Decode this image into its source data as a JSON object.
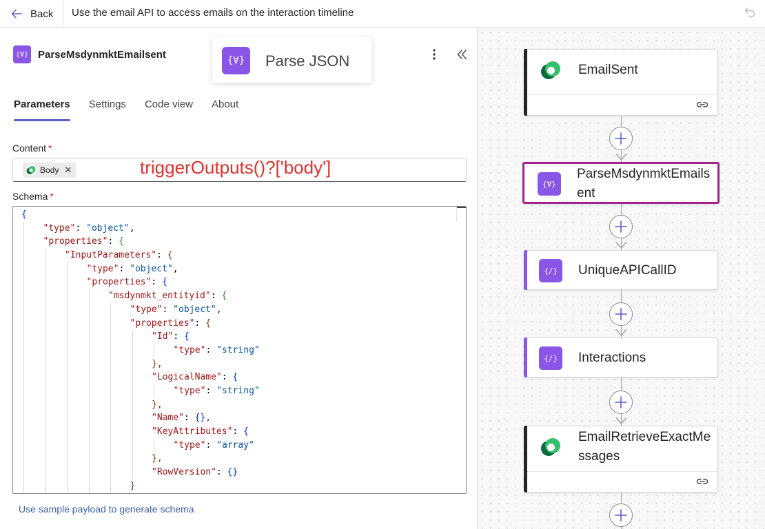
{
  "topbar": {
    "back_label": "Back",
    "title": "Use the email API to access emails on the interaction timeline"
  },
  "panel": {
    "action_name": "ParseMsdynmktEmailsent",
    "action_icon_glyph": "{∀}",
    "hover_label": "Parse JSON",
    "tabs": [
      {
        "label": "Parameters",
        "active": true
      },
      {
        "label": "Settings",
        "active": false
      },
      {
        "label": "Code view",
        "active": false
      },
      {
        "label": "About",
        "active": false
      }
    ],
    "content_label": "Content",
    "required_mark": "*",
    "content_token": "Body",
    "token_remove": "✕",
    "annotation": "triggerOutputs()?['body']",
    "schema_label": "Schema",
    "sample_link": "Use sample payload to generate schema"
  },
  "schema_lines": [
    [
      "b1",
      0,
      "{"
    ],
    [
      "kv",
      1,
      "\"type\"",
      "\"object\"",
      ","
    ],
    [
      "ko",
      1,
      "\"properties\"",
      "{"
    ],
    [
      "ko",
      2,
      "\"InputParameters\"",
      "{"
    ],
    [
      "kv",
      3,
      "\"type\"",
      "\"object\"",
      ","
    ],
    [
      "ko",
      3,
      "\"properties\"",
      "{"
    ],
    [
      "ko",
      4,
      "\"msdynmkt_entityid\"",
      "{"
    ],
    [
      "kv",
      5,
      "\"type\"",
      "\"object\"",
      ","
    ],
    [
      "ko",
      5,
      "\"properties\"",
      "{"
    ],
    [
      "ko",
      6,
      "\"Id\"",
      "{"
    ],
    [
      "kv",
      7,
      "\"type\"",
      "\"string\"",
      ""
    ],
    [
      "cl",
      6,
      "},"
    ],
    [
      "ko",
      6,
      "\"LogicalName\"",
      "{"
    ],
    [
      "kv",
      7,
      "\"type\"",
      "\"string\"",
      ""
    ],
    [
      "cl",
      6,
      "},"
    ],
    [
      "ke",
      6,
      "\"Name\"",
      "{},"
    ],
    [
      "ko",
      6,
      "\"KeyAttributes\"",
      "{"
    ],
    [
      "kv",
      7,
      "\"type\"",
      "\"array\"",
      ""
    ],
    [
      "cl",
      6,
      "},"
    ],
    [
      "ke",
      6,
      "\"RowVersion\"",
      "{}"
    ],
    [
      "cl",
      5,
      "}"
    ]
  ],
  "flow": {
    "colors": {
      "dataverse": "#1b8a5a",
      "json": "#8a56e8",
      "selected_border": "#a3238e",
      "tab_underline": "#5b5fc7",
      "annotation": "#e03030"
    },
    "cards": [
      {
        "title": "EmailSent",
        "icon": "dataverse-icon",
        "has_link": true
      },
      {
        "title": "ParseMsdynmktEmailsent",
        "icon": "parse-json-icon",
        "selected": true
      },
      {
        "title": "UniqueAPICallID",
        "icon": "compose-icon"
      },
      {
        "title": "Interactions",
        "icon": "compose-icon"
      },
      {
        "title": "EmailRetrieveExactMessages",
        "icon": "dataverse-icon",
        "has_link": true
      }
    ]
  }
}
